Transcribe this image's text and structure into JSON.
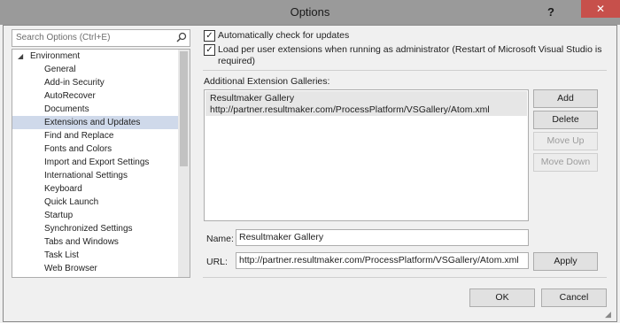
{
  "window": {
    "title": "Options",
    "help": "?",
    "close": "✕"
  },
  "search": {
    "placeholder": "Search Options (Ctrl+E)"
  },
  "tree": {
    "root": "Environment",
    "children": [
      "General",
      "Add-in Security",
      "AutoRecover",
      "Documents",
      "Extensions and Updates",
      "Find and Replace",
      "Fonts and Colors",
      "Import and Export Settings",
      "International Settings",
      "Keyboard",
      "Quick Launch",
      "Startup",
      "Synchronized Settings",
      "Tabs and Windows",
      "Task List",
      "Web Browser"
    ],
    "selected": "Extensions and Updates"
  },
  "options": {
    "auto_check": {
      "label": "Automatically check for updates",
      "checked": true
    },
    "load_ext_line1": "Load per user extensions when running as administrator (Restart of Microsoft Visual Studio is",
    "load_ext_line2": "required)"
  },
  "galleries": {
    "label": "Additional Extension Galleries:",
    "items": [
      {
        "name": "Resultmaker Gallery",
        "url": "http://partner.resultmaker.com/ProcessPlatform/VSGallery/Atom.xml"
      }
    ]
  },
  "buttons": {
    "add": "Add",
    "delete": "Delete",
    "move_up": "Move Up",
    "move_down": "Move Down",
    "apply": "Apply",
    "ok": "OK",
    "cancel": "Cancel"
  },
  "form": {
    "name_label": "Name:",
    "name_value": "Resultmaker Gallery",
    "url_label": "URL:",
    "url_value": "http://partner.resultmaker.com/ProcessPlatform/VSGallery/Atom.xml"
  }
}
